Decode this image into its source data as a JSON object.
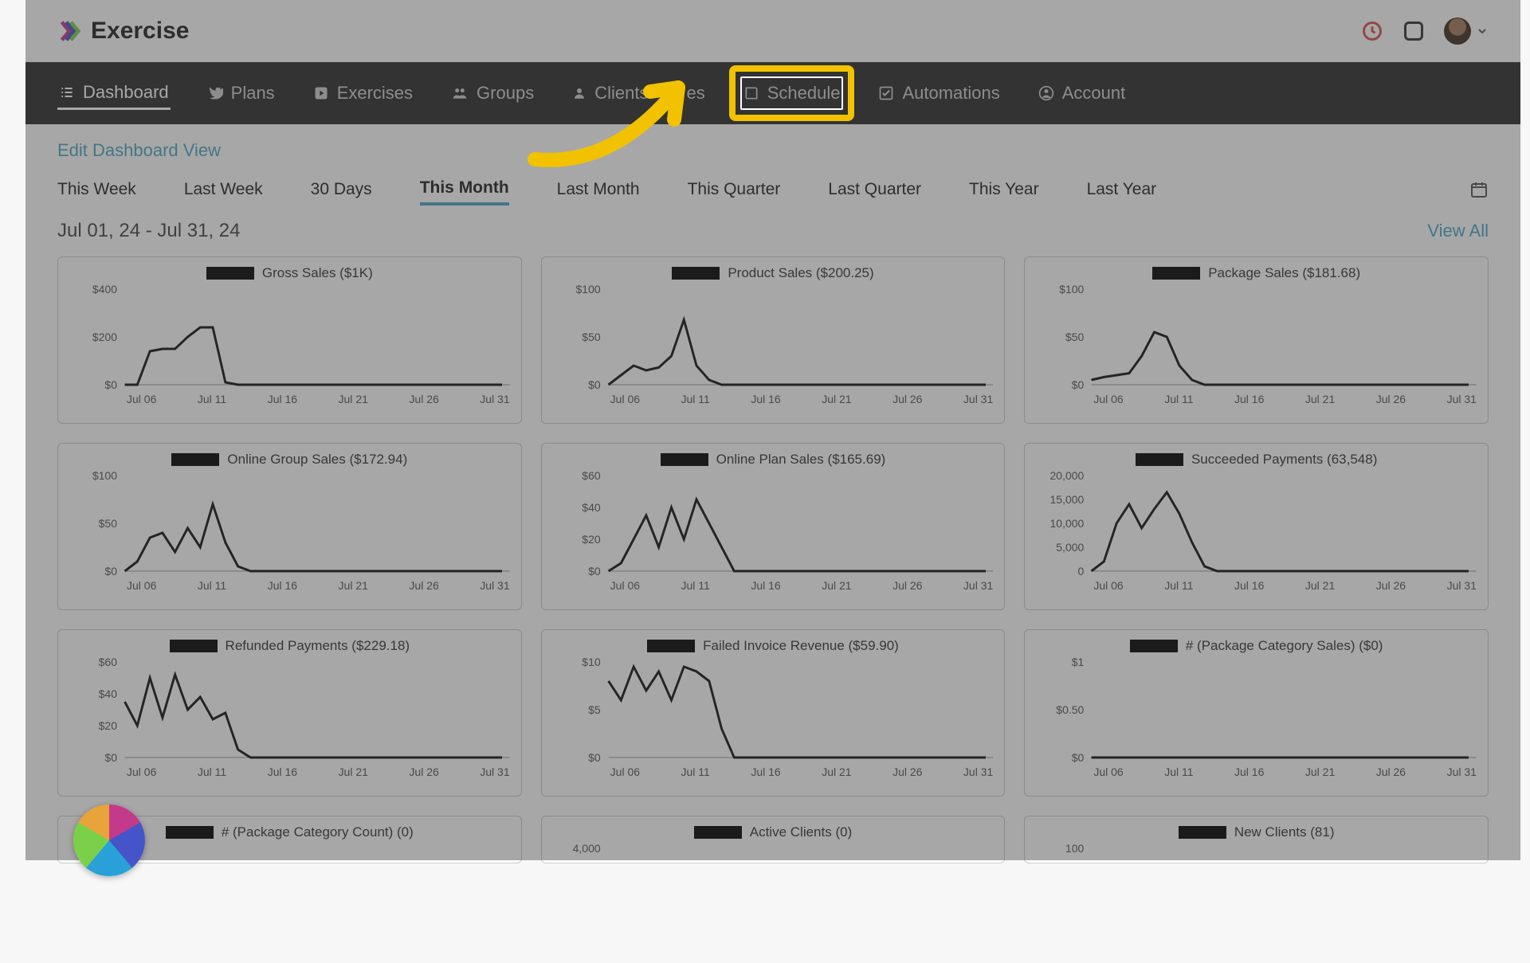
{
  "brand": "Exercise",
  "nav": [
    {
      "icon": "list",
      "label": "Dashboard",
      "active": true
    },
    {
      "icon": "bird",
      "label": "Plans"
    },
    {
      "icon": "play",
      "label": "Exercises"
    },
    {
      "icon": "group",
      "label": "Groups"
    },
    {
      "icon": "user",
      "label": "Clients"
    },
    {
      "icon": "",
      "label": "es"
    },
    {
      "icon": "book",
      "label": "Schedule",
      "highlighted": true
    },
    {
      "icon": "check",
      "label": "Automations"
    },
    {
      "icon": "account",
      "label": "Account"
    }
  ],
  "edit_link": "Edit Dashboard View",
  "range_tabs": [
    "This Week",
    "Last Week",
    "30 Days",
    "This Month",
    "Last Month",
    "This Quarter",
    "Last Quarter",
    "This Year",
    "Last Year"
  ],
  "range_active": "This Month",
  "date_range": "Jul 01, 24 - Jul 31, 24",
  "view_all": "View All",
  "x_categories": [
    "Jul 06",
    "Jul 11",
    "Jul 16",
    "Jul 21",
    "Jul 26",
    "Jul 31"
  ],
  "chart_data": [
    {
      "type": "line",
      "title": "Gross Sales ($1K)",
      "yticks": [
        "$400",
        "$200",
        "$0"
      ],
      "ymax": 400,
      "values": [
        0,
        0,
        140,
        150,
        150,
        200,
        240,
        240,
        10,
        0,
        0,
        0,
        0,
        0,
        0,
        0,
        0,
        0,
        0,
        0,
        0,
        0,
        0,
        0,
        0,
        0,
        0,
        0,
        0,
        0,
        0
      ]
    },
    {
      "type": "line",
      "title": "Product Sales ($200.25)",
      "yticks": [
        "$100",
        "$50",
        "$0"
      ],
      "ymax": 100,
      "values": [
        0,
        10,
        20,
        15,
        18,
        30,
        68,
        20,
        5,
        0,
        0,
        0,
        0,
        0,
        0,
        0,
        0,
        0,
        0,
        0,
        0,
        0,
        0,
        0,
        0,
        0,
        0,
        0,
        0,
        0,
        0
      ]
    },
    {
      "type": "line",
      "title": "Package Sales ($181.68)",
      "yticks": [
        "$100",
        "$50",
        "$0"
      ],
      "ymax": 100,
      "values": [
        5,
        8,
        10,
        12,
        30,
        55,
        50,
        20,
        5,
        0,
        0,
        0,
        0,
        0,
        0,
        0,
        0,
        0,
        0,
        0,
        0,
        0,
        0,
        0,
        0,
        0,
        0,
        0,
        0,
        0,
        0
      ]
    },
    {
      "type": "line",
      "title": "Online Group Sales ($172.94)",
      "yticks": [
        "$100",
        "$50",
        "$0"
      ],
      "ymax": 100,
      "values": [
        0,
        10,
        35,
        40,
        20,
        45,
        25,
        70,
        30,
        5,
        0,
        0,
        0,
        0,
        0,
        0,
        0,
        0,
        0,
        0,
        0,
        0,
        0,
        0,
        0,
        0,
        0,
        0,
        0,
        0,
        0
      ]
    },
    {
      "type": "line",
      "title": "Online Plan Sales ($165.69)",
      "yticks": [
        "$60",
        "$40",
        "$20",
        "$0"
      ],
      "ymax": 60,
      "values": [
        0,
        5,
        20,
        35,
        15,
        40,
        20,
        45,
        30,
        15,
        0,
        0,
        0,
        0,
        0,
        0,
        0,
        0,
        0,
        0,
        0,
        0,
        0,
        0,
        0,
        0,
        0,
        0,
        0,
        0,
        0
      ]
    },
    {
      "type": "line",
      "title": "Succeeded Payments (63,548)",
      "yticks": [
        "20,000",
        "15,000",
        "10,000",
        "5,000",
        "0"
      ],
      "ymax": 20000,
      "values": [
        0,
        2000,
        10000,
        14000,
        9000,
        13000,
        16500,
        12000,
        6000,
        1000,
        0,
        0,
        0,
        0,
        0,
        0,
        0,
        0,
        0,
        0,
        0,
        0,
        0,
        0,
        0,
        0,
        0,
        0,
        0,
        0,
        0
      ]
    },
    {
      "type": "line",
      "title": "Refunded Payments ($229.18)",
      "yticks": [
        "$60",
        "$40",
        "$20",
        "$0"
      ],
      "ymax": 60,
      "values": [
        35,
        20,
        50,
        25,
        52,
        30,
        38,
        24,
        28,
        5,
        0,
        0,
        0,
        0,
        0,
        0,
        0,
        0,
        0,
        0,
        0,
        0,
        0,
        0,
        0,
        0,
        0,
        0,
        0,
        0,
        0
      ]
    },
    {
      "type": "line",
      "title": "Failed Invoice Revenue ($59.90)",
      "yticks": [
        "$10",
        "$5",
        "$0"
      ],
      "ymax": 10,
      "values": [
        8,
        6,
        9.5,
        7,
        9,
        6,
        9.5,
        9,
        8,
        3,
        0,
        0,
        0,
        0,
        0,
        0,
        0,
        0,
        0,
        0,
        0,
        0,
        0,
        0,
        0,
        0,
        0,
        0,
        0,
        0,
        0
      ]
    },
    {
      "type": "line",
      "title": "# (Package Category Sales) ($0)",
      "yticks": [
        "$1",
        "$0.50",
        "$0"
      ],
      "ymax": 1,
      "values": [
        0,
        0,
        0,
        0,
        0,
        0,
        0,
        0,
        0,
        0,
        0,
        0,
        0,
        0,
        0,
        0,
        0,
        0,
        0,
        0,
        0,
        0,
        0,
        0,
        0,
        0,
        0,
        0,
        0,
        0,
        0
      ]
    },
    {
      "type": "line",
      "title": "# (Package Category Count) (0)",
      "yticks": [
        "100"
      ],
      "ymax": 100,
      "values": []
    },
    {
      "type": "line",
      "title": "Active Clients (0)",
      "yticks": [
        "4,000"
      ],
      "ymax": 4000,
      "values": []
    },
    {
      "type": "line",
      "title": "New Clients (81)",
      "yticks": [
        "100"
      ],
      "ymax": 100,
      "values": []
    }
  ]
}
